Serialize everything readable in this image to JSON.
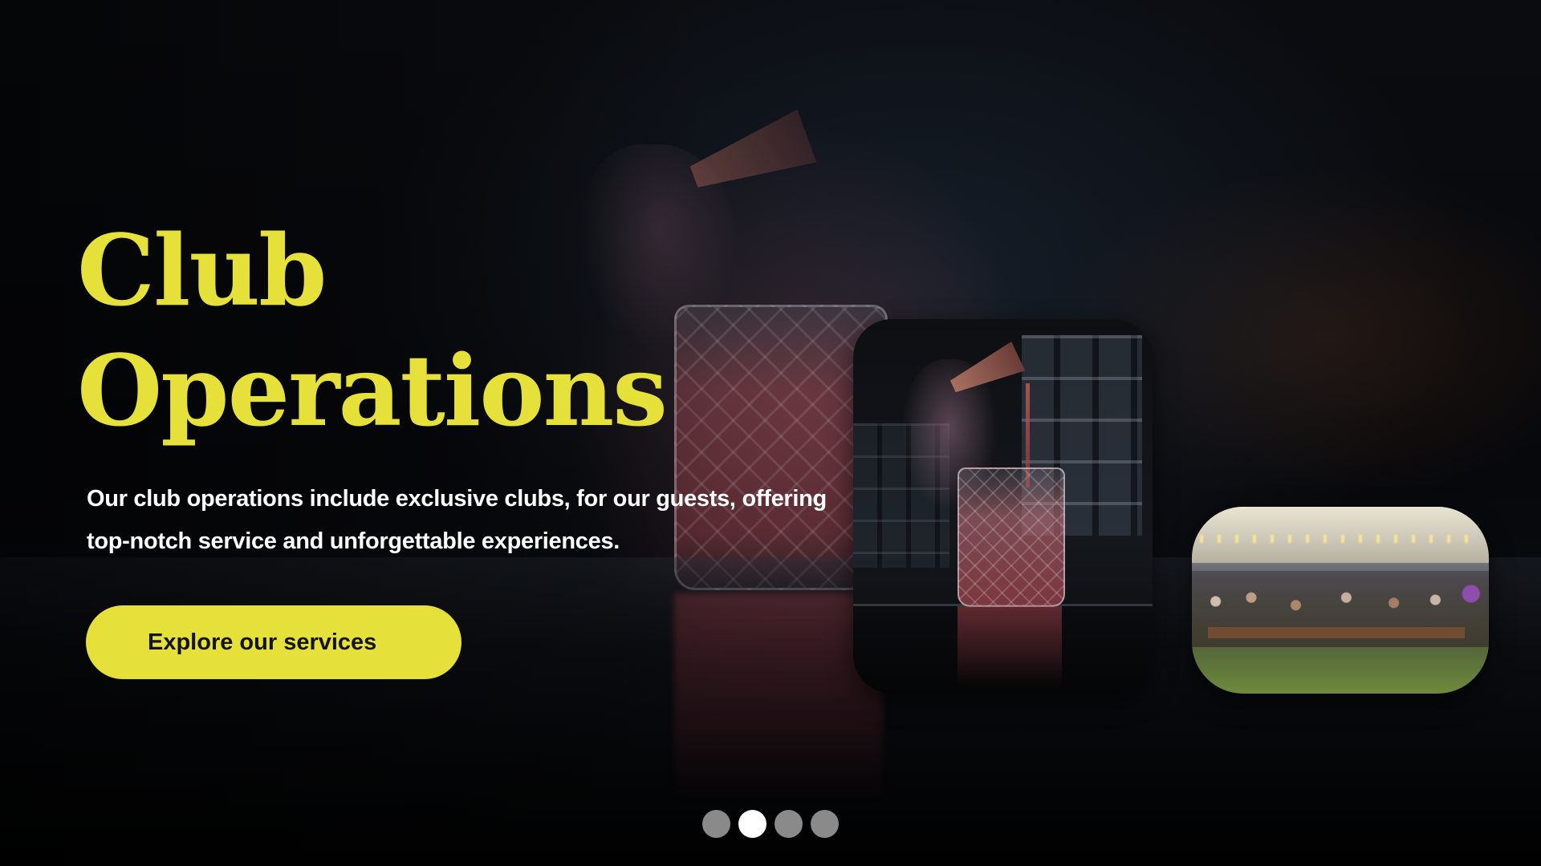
{
  "hero": {
    "title_line1": "Club",
    "title_line2": "Operations",
    "description": "Our club operations include exclusive clubs, for our guests, offering top-notch service and unforgettable experiences.",
    "cta_label": "Explore our services"
  },
  "carousel": {
    "slide_count": 4,
    "active_index": 1
  },
  "theme": {
    "accent": "#e6e03a",
    "text": "#ffffff",
    "background": "#050506",
    "dot_inactive": "#8a8a8a",
    "dot_active": "#ffffff"
  }
}
